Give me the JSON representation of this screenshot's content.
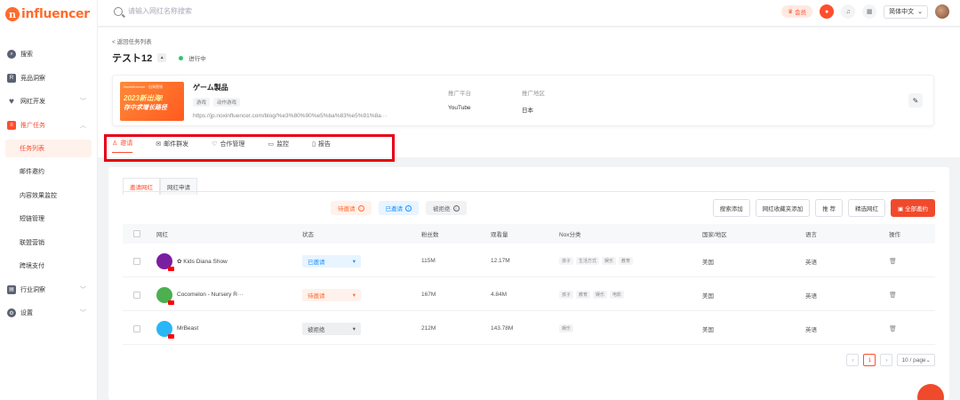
{
  "app": {
    "logo_mark": "n",
    "logo_text": "influencer"
  },
  "sidebar": {
    "items": [
      {
        "label": "搜索",
        "icon": "search-icon"
      },
      {
        "label": "竞品洞察",
        "icon": "chart-icon"
      },
      {
        "label": "网红开发",
        "icon": "heart-icon",
        "chevron": "﹀"
      },
      {
        "label": "推广任务",
        "icon": "task-icon",
        "chevron": "︿"
      }
    ],
    "sub_items": [
      "任务列表",
      "邮件邀约",
      "内容效果监控",
      "短链管理",
      "联盟营销",
      "跨境支付"
    ],
    "bottom_items": [
      {
        "label": "行业洞察",
        "icon": "industry-icon",
        "chevron": "﹀"
      },
      {
        "label": "设置",
        "icon": "settings-icon",
        "chevron": "﹀"
      }
    ]
  },
  "topbar": {
    "search_placeholder": "请输入网红名称搜索",
    "vip_label": "会员",
    "language": "简体中文"
  },
  "header": {
    "back_label": "< 返回任务列表",
    "task_name": "テスト12",
    "status": "进行中",
    "card": {
      "thumb_top": "Noxinfluencer · 出海营销",
      "thumb_line1": "2023新出海!",
      "thumb_line2": "存中求增长路径",
      "product_name": "ゲーム製品",
      "tags": [
        "游戏",
        "动作游戏"
      ],
      "url": "https://jp.noxinfluencer.com/blog/%e3%80%90%e5%ba%83%e5%91%8a···",
      "platform_label": "推广平台",
      "platform_value": "YouTube",
      "region_label": "推广地区",
      "region_value": "日本"
    },
    "tabs": [
      "邀请",
      "邮件群发",
      "合作管理",
      "监控",
      "报告"
    ]
  },
  "main": {
    "subtabs": [
      "邀请网红",
      "网红申请"
    ],
    "filters": {
      "pending": "待邀请",
      "invited": "已邀请",
      "rejected": "被拒绝"
    },
    "actions": [
      "搜索添加",
      "网红收藏夹添加",
      "推 荐",
      "精选网红",
      "全部邀约"
    ],
    "columns": [
      "网红",
      "状态",
      "粉丝数",
      "观看量",
      "Nox分类",
      "国家/地区",
      "语言",
      "操作"
    ],
    "rows": [
      {
        "name": "✿ Kids Diana Show",
        "status": "已邀请",
        "status_type": "invited",
        "followers": "115M",
        "views": "12.17M",
        "tags": [
          "孩子",
          "生活方式",
          "娱乐",
          "教育"
        ],
        "country": "美国",
        "language": "英语",
        "avatar_color": "#7b1fa2"
      },
      {
        "name": "Cocomelon - Nursery R···",
        "status": "待邀请",
        "status_type": "pending",
        "followers": "167M",
        "views": "4.84M",
        "tags": [
          "孩子",
          "教育",
          "娱乐",
          "电影"
        ],
        "country": "美国",
        "language": "英语",
        "avatar_color": "#4caf50"
      },
      {
        "name": "MrBeast",
        "status": "被拒绝",
        "status_type": "rejected",
        "followers": "212M",
        "views": "143.78M",
        "tags": [
          "娱乐"
        ],
        "country": "美国",
        "language": "英语",
        "avatar_color": "#29b6f6"
      }
    ],
    "pagination": {
      "current": "1",
      "page_size": "10 / page"
    }
  }
}
